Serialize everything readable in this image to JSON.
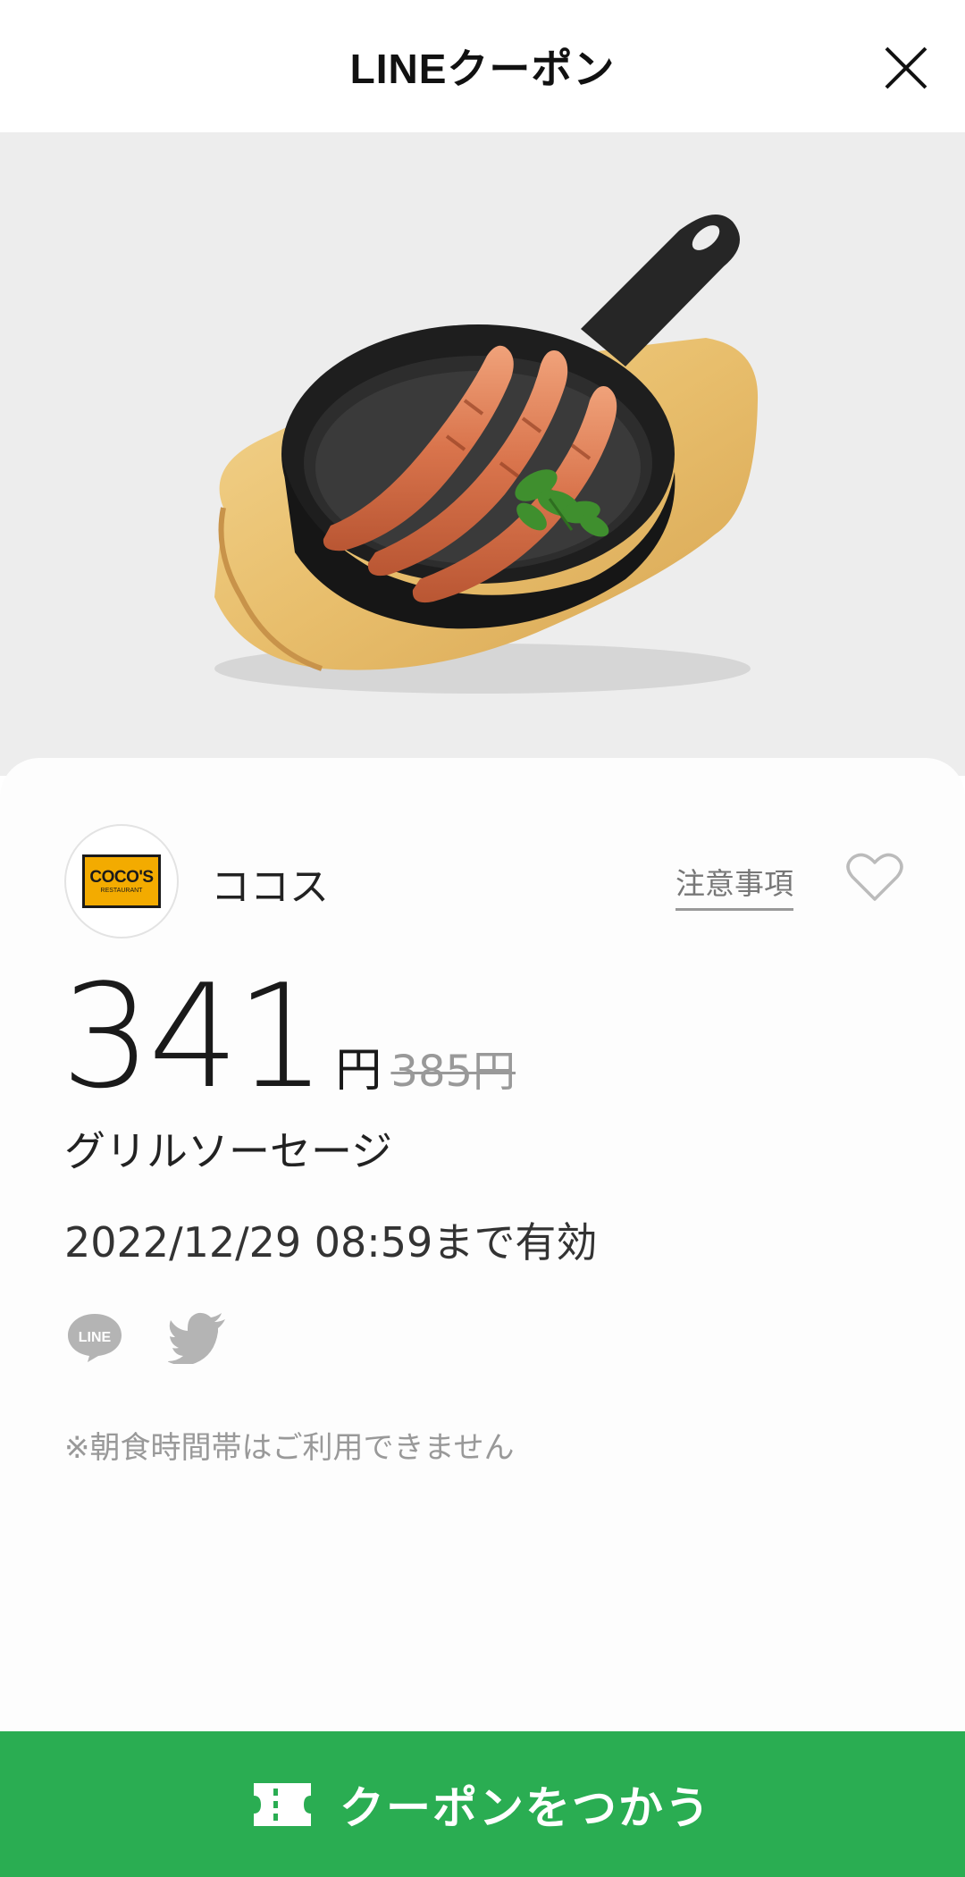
{
  "header": {
    "title": "LINEクーポン",
    "close_icon": "close-icon"
  },
  "hero": {
    "image": "sausage-skillet-photo"
  },
  "store": {
    "name": "ココス",
    "logo_text": "COCO'S",
    "logo_subtext": "RESTAURANT"
  },
  "links": {
    "notes": "注意事項"
  },
  "price": {
    "current": "341",
    "unit": "円",
    "original": "385円"
  },
  "product": {
    "name": "グリルソーセージ"
  },
  "validity": {
    "text": "2022/12/29  08:59まで有効"
  },
  "share": {
    "line_label": "LINE",
    "icons": [
      "line-share-icon",
      "twitter-share-icon"
    ]
  },
  "notice": {
    "text": "※朝食時間帯はご利用できません"
  },
  "action": {
    "use_label": "クーポンをつかう"
  },
  "colors": {
    "accent_green": "#2aad52",
    "hero_bg": "#ededed"
  }
}
